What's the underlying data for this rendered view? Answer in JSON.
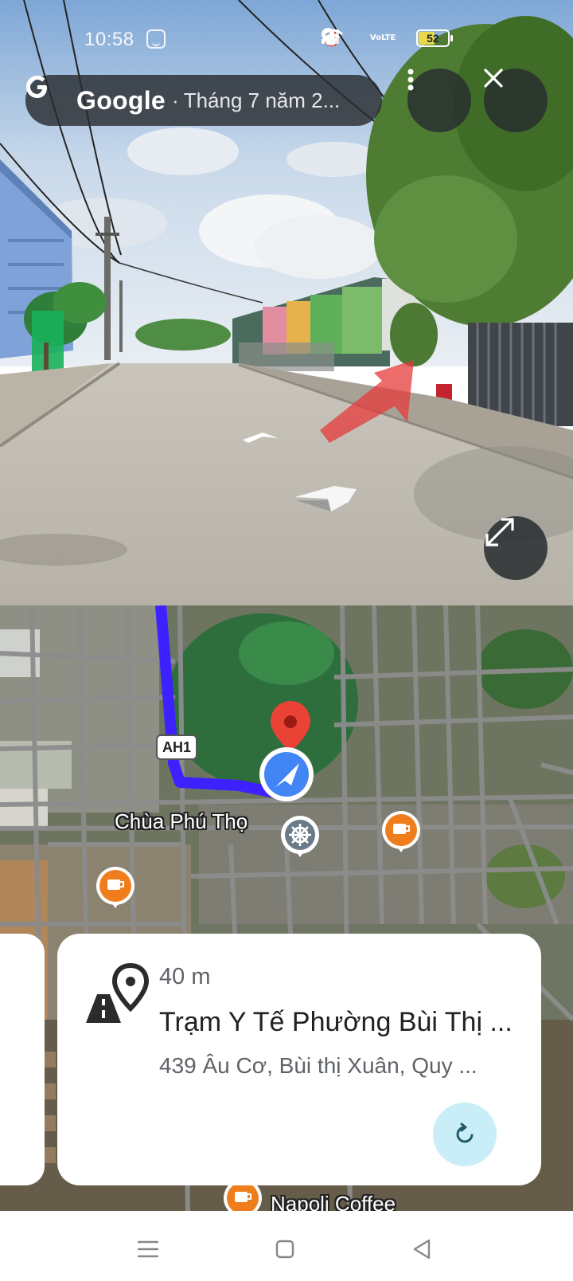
{
  "status_bar": {
    "time": "10:58",
    "battery": "52",
    "volte": "VoLTE",
    "icons": [
      "face-icon",
      "alarm-icon",
      "location-icon",
      "wifi-icon",
      "volte-icon",
      "signal-icon",
      "signal-icon",
      "battery-icon"
    ]
  },
  "header": {
    "brand": "Google",
    "separator": "·",
    "date": "Tháng 7 năm 2...",
    "icons": [
      "google-g-icon",
      "more-vert-icon",
      "close-icon",
      "expand-icon"
    ]
  },
  "map": {
    "road_shield": "AH1",
    "place_label": "Chùa Phú Thọ",
    "bottom_label": "Napoli Coffee",
    "icons": [
      "destination-pin-icon",
      "navigation-arrow-icon",
      "temple-icon",
      "coffee-icon"
    ],
    "colors": {
      "route": "#3d22ff",
      "current_location": "#4285f4",
      "destination_pin": "#ea4335",
      "poi_coffee": "#f07d1c"
    }
  },
  "card": {
    "distance": "40 m",
    "title": "Trạm Y Tế Phường Bùi Thị ...",
    "address": "439 Âu Cơ, Bùi thị Xuân, Quy ...",
    "icons": [
      "directions-pin-icon",
      "refresh-icon"
    ]
  },
  "nav_bar": {
    "icons": [
      "menu-icon",
      "home-icon",
      "back-icon"
    ]
  }
}
